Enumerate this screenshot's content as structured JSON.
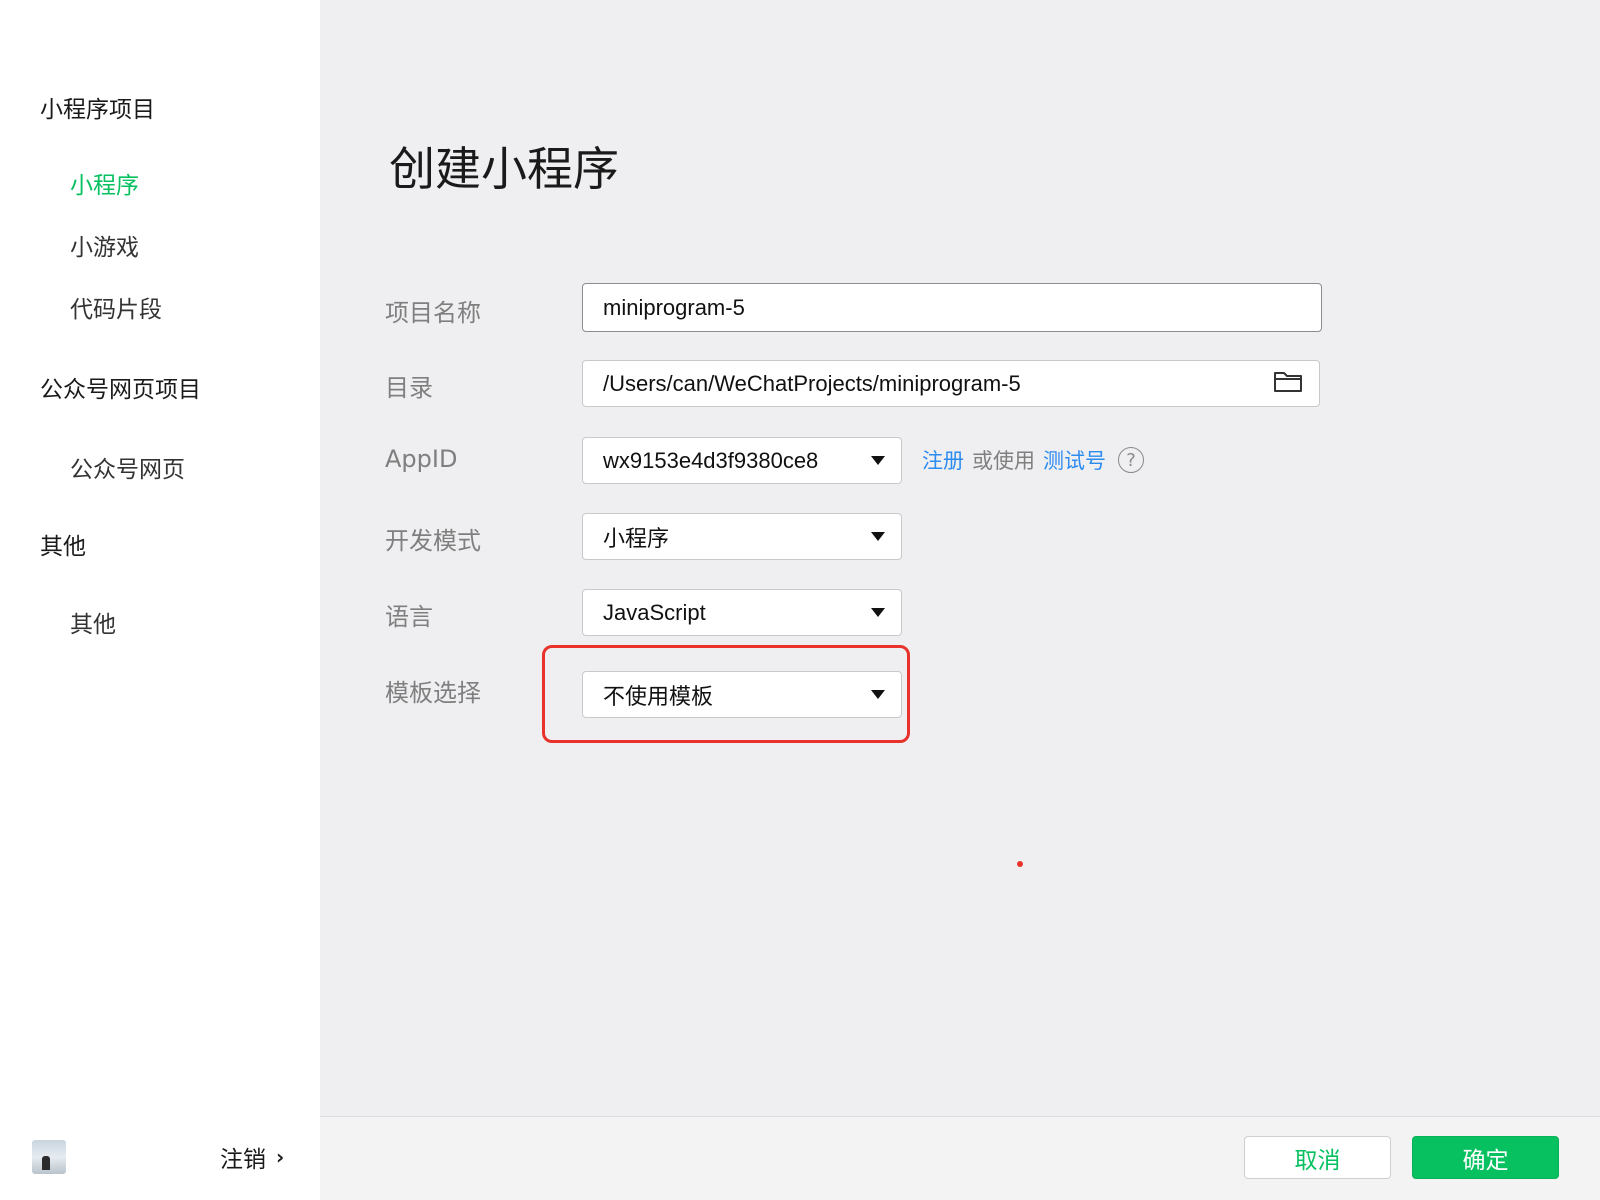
{
  "sidebar": {
    "groups": [
      {
        "label": "小程序项目",
        "items": [
          "小程序",
          "小游戏",
          "代码片段"
        ]
      },
      {
        "label": "公众号网页项目",
        "items": [
          "公众号网页"
        ]
      },
      {
        "label": "其他",
        "items": [
          "其他"
        ]
      }
    ],
    "active_item": "小程序",
    "logout_label": "注销"
  },
  "main": {
    "title": "创建小程序",
    "form": {
      "project_name": {
        "label": "项目名称",
        "value": "miniprogram-5"
      },
      "directory": {
        "label": "目录",
        "value": "/Users/can/WeChatProjects/miniprogram-5"
      },
      "appid": {
        "label": "AppID",
        "value": "wx9153e4d3f9380ce8",
        "register_link": "注册",
        "or_use_text": "或使用",
        "test_account_link": "测试号",
        "help_glyph": "?"
      },
      "dev_mode": {
        "label": "开发模式",
        "value": "小程序"
      },
      "language": {
        "label": "语言",
        "value": "JavaScript"
      },
      "template": {
        "label": "模板选择",
        "value": "不使用模板"
      }
    }
  },
  "footer": {
    "cancel_label": "取消",
    "confirm_label": "确定"
  },
  "colors": {
    "accent_green": "#07c160",
    "link_blue": "#2d8cf0",
    "highlight_red": "#e8322b"
  }
}
